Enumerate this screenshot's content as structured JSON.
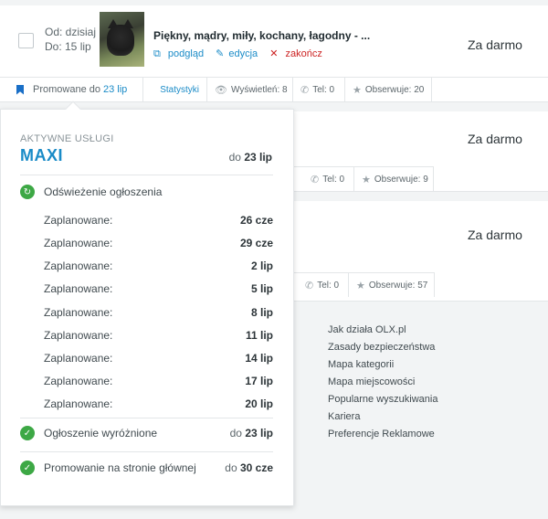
{
  "ads": [
    {
      "date_from": "Od: dzisiaj",
      "date_to": "Do: 15 lip",
      "title": "Piękny, mądry, miły, kochany, łagodny - ...",
      "actions": {
        "preview": "podgląd",
        "edit": "edycja",
        "end": "zakończ"
      },
      "price": "Za darmo",
      "promo_label": "Promowane do",
      "promo_date": "23 lip",
      "stats_link": "Statystyki",
      "views": "Wyświetleń: 8",
      "phone": "Tel: 0",
      "watch": "Obserwuje: 20"
    },
    {
      "price": "Za darmo",
      "phone": "Tel: 0",
      "watch": "Obserwuje: 9"
    },
    {
      "price": "Za darmo",
      "phone": "Tel: 0",
      "watch": "Obserwuje: 57"
    }
  ],
  "footer_links": [
    "Jak działa OLX.pl",
    "Zasady bezpieczeństwa",
    "Mapa kategorii",
    "Mapa miejscowości",
    "Popularne wyszukiwania",
    "Kariera",
    "Preferencje Reklamowe"
  ],
  "popup": {
    "subtitle": "AKTYWNE USŁUGI",
    "plan": "MAXI",
    "plan_date_prefix": "do",
    "plan_date": "23 lip",
    "refresh_label": "Odświeżenie ogłoszenia",
    "schedule": [
      {
        "label": "Zaplanowane:",
        "value": "26 cze"
      },
      {
        "label": "Zaplanowane:",
        "value": "29 cze"
      },
      {
        "label": "Zaplanowane:",
        "value": "2 lip"
      },
      {
        "label": "Zaplanowane:",
        "value": "5 lip"
      },
      {
        "label": "Zaplanowane:",
        "value": "8 lip"
      },
      {
        "label": "Zaplanowane:",
        "value": "11 lip"
      },
      {
        "label": "Zaplanowane:",
        "value": "14 lip"
      },
      {
        "label": "Zaplanowane:",
        "value": "17 lip"
      },
      {
        "label": "Zaplanowane:",
        "value": "20 lip"
      }
    ],
    "featured_label": "Ogłoszenie wyróżnione",
    "featured_date_prefix": "do",
    "featured_date": "23 lip",
    "homepage_label": "Promowanie na stronie głównej",
    "homepage_date_prefix": "do",
    "homepage_date": "30 cze"
  },
  "colors": {
    "accent": "#1a8bc7",
    "success": "#3da845",
    "danger": "#cc2222"
  }
}
